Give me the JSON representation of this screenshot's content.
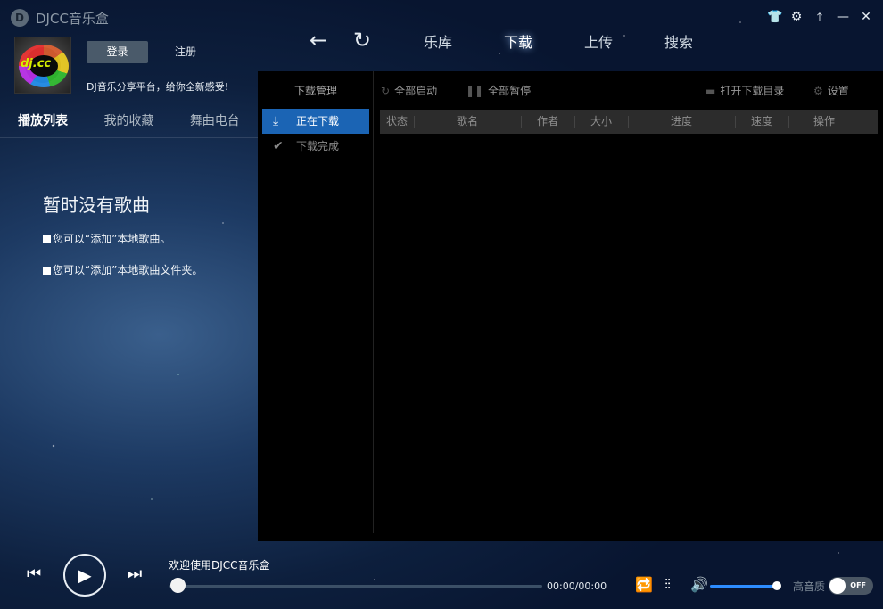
{
  "app": {
    "logo_letter": "D",
    "title": "DJCC音乐盒"
  },
  "window_controls": {
    "skin": "👕",
    "settings": "⚙",
    "pin": "⤒",
    "minimize": "—",
    "close": "✕"
  },
  "nav": {
    "back": "←",
    "refresh": "↻",
    "tabs": [
      {
        "label": "乐库"
      },
      {
        "label": "下载"
      },
      {
        "label": "上传"
      },
      {
        "label": "搜索"
      }
    ],
    "active_tab": "下载"
  },
  "user": {
    "avatar_text": "dj.cc",
    "login_label": "登录",
    "register_label": "注册",
    "slogan": "DJ音乐分享平台，给你全新感受!"
  },
  "left_tabs": [
    {
      "label": "播放列表"
    },
    {
      "label": "我的收藏"
    },
    {
      "label": "舞曲电台"
    }
  ],
  "playlist_empty": {
    "title": "暂时没有歌曲",
    "hint1": "您可以“添加”本地歌曲。",
    "hint2": "您可以“添加”本地歌曲文件夹。"
  },
  "download": {
    "sidebar_title": "下载管理",
    "items": [
      {
        "icon": "⤓",
        "label": "正在下载"
      },
      {
        "icon": "✔",
        "label": "下载完成"
      }
    ],
    "toolbar": {
      "start_all": "全部启动",
      "pause_all": "全部暂停",
      "open_dir": "打开下载目录",
      "settings": "设置"
    },
    "columns": [
      "状态",
      "歌名",
      "作者",
      "大小",
      "进度",
      "速度",
      "操作"
    ]
  },
  "player": {
    "prev": "⏮",
    "play": "▶",
    "next": "⏭",
    "now_playing": "欢迎使用DJCC音乐盒",
    "time": "00:00/00:00",
    "progress": 0,
    "volume": 0.93,
    "hq_label": "高音质",
    "hq_state": "OFF"
  }
}
